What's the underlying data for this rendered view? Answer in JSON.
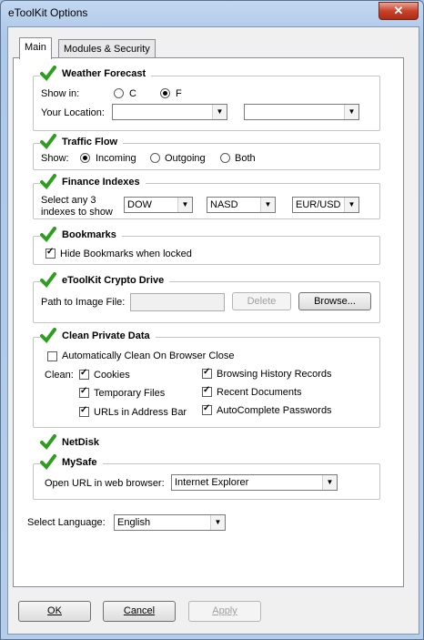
{
  "window": {
    "title": "eToolKit Options",
    "close_glyph": "✕"
  },
  "tabs": [
    {
      "label": "Main"
    },
    {
      "label": "Modules & Security"
    }
  ],
  "weather": {
    "title": "Weather Forecast",
    "show_in_label": "Show in:",
    "unit_c": "C",
    "unit_f": "F",
    "selected_unit": "F",
    "location_label": "Your Location:",
    "location_value_1": "",
    "location_value_2": ""
  },
  "traffic": {
    "title": "Traffic Flow",
    "show_label": "Show:",
    "options": [
      "Incoming",
      "Outgoing",
      "Both"
    ],
    "selected": "Incoming"
  },
  "finance": {
    "title": "Finance Indexes",
    "select_label_1": "Select any 3",
    "select_label_2": "indexes to show",
    "index_1": "DOW",
    "index_2": "NASD",
    "index_3": "EUR/USD"
  },
  "bookmarks": {
    "title": "Bookmarks",
    "hide_label": "Hide Bookmarks when locked",
    "hide_checked": true
  },
  "crypto": {
    "title": "eToolKit Crypto Drive",
    "path_label": "Path to Image File:",
    "path_value": "",
    "delete_label": "Delete",
    "browse_label": "Browse..."
  },
  "clean": {
    "title": "Clean Private Data",
    "auto_label": "Automatically Clean On Browser Close",
    "auto_checked": false,
    "clean_label": "Clean:",
    "items_left": [
      "Cookies",
      "Temporary Files",
      "URLs in Address Bar"
    ],
    "items_right": [
      "Browsing History Records",
      "Recent Documents",
      "AutoComplete Passwords"
    ]
  },
  "netdisk": {
    "title": "NetDisk"
  },
  "mysafe": {
    "title": "MySafe",
    "open_label": "Open URL in web browser:",
    "browser": "Internet Explorer"
  },
  "language": {
    "label": "Select Language:",
    "value": "English"
  },
  "buttons": {
    "ok": "OK",
    "cancel": "Cancel",
    "apply": "Apply"
  },
  "colors": {
    "check_green": "#2e9e1f",
    "title_bar": "#b9d1ee"
  }
}
